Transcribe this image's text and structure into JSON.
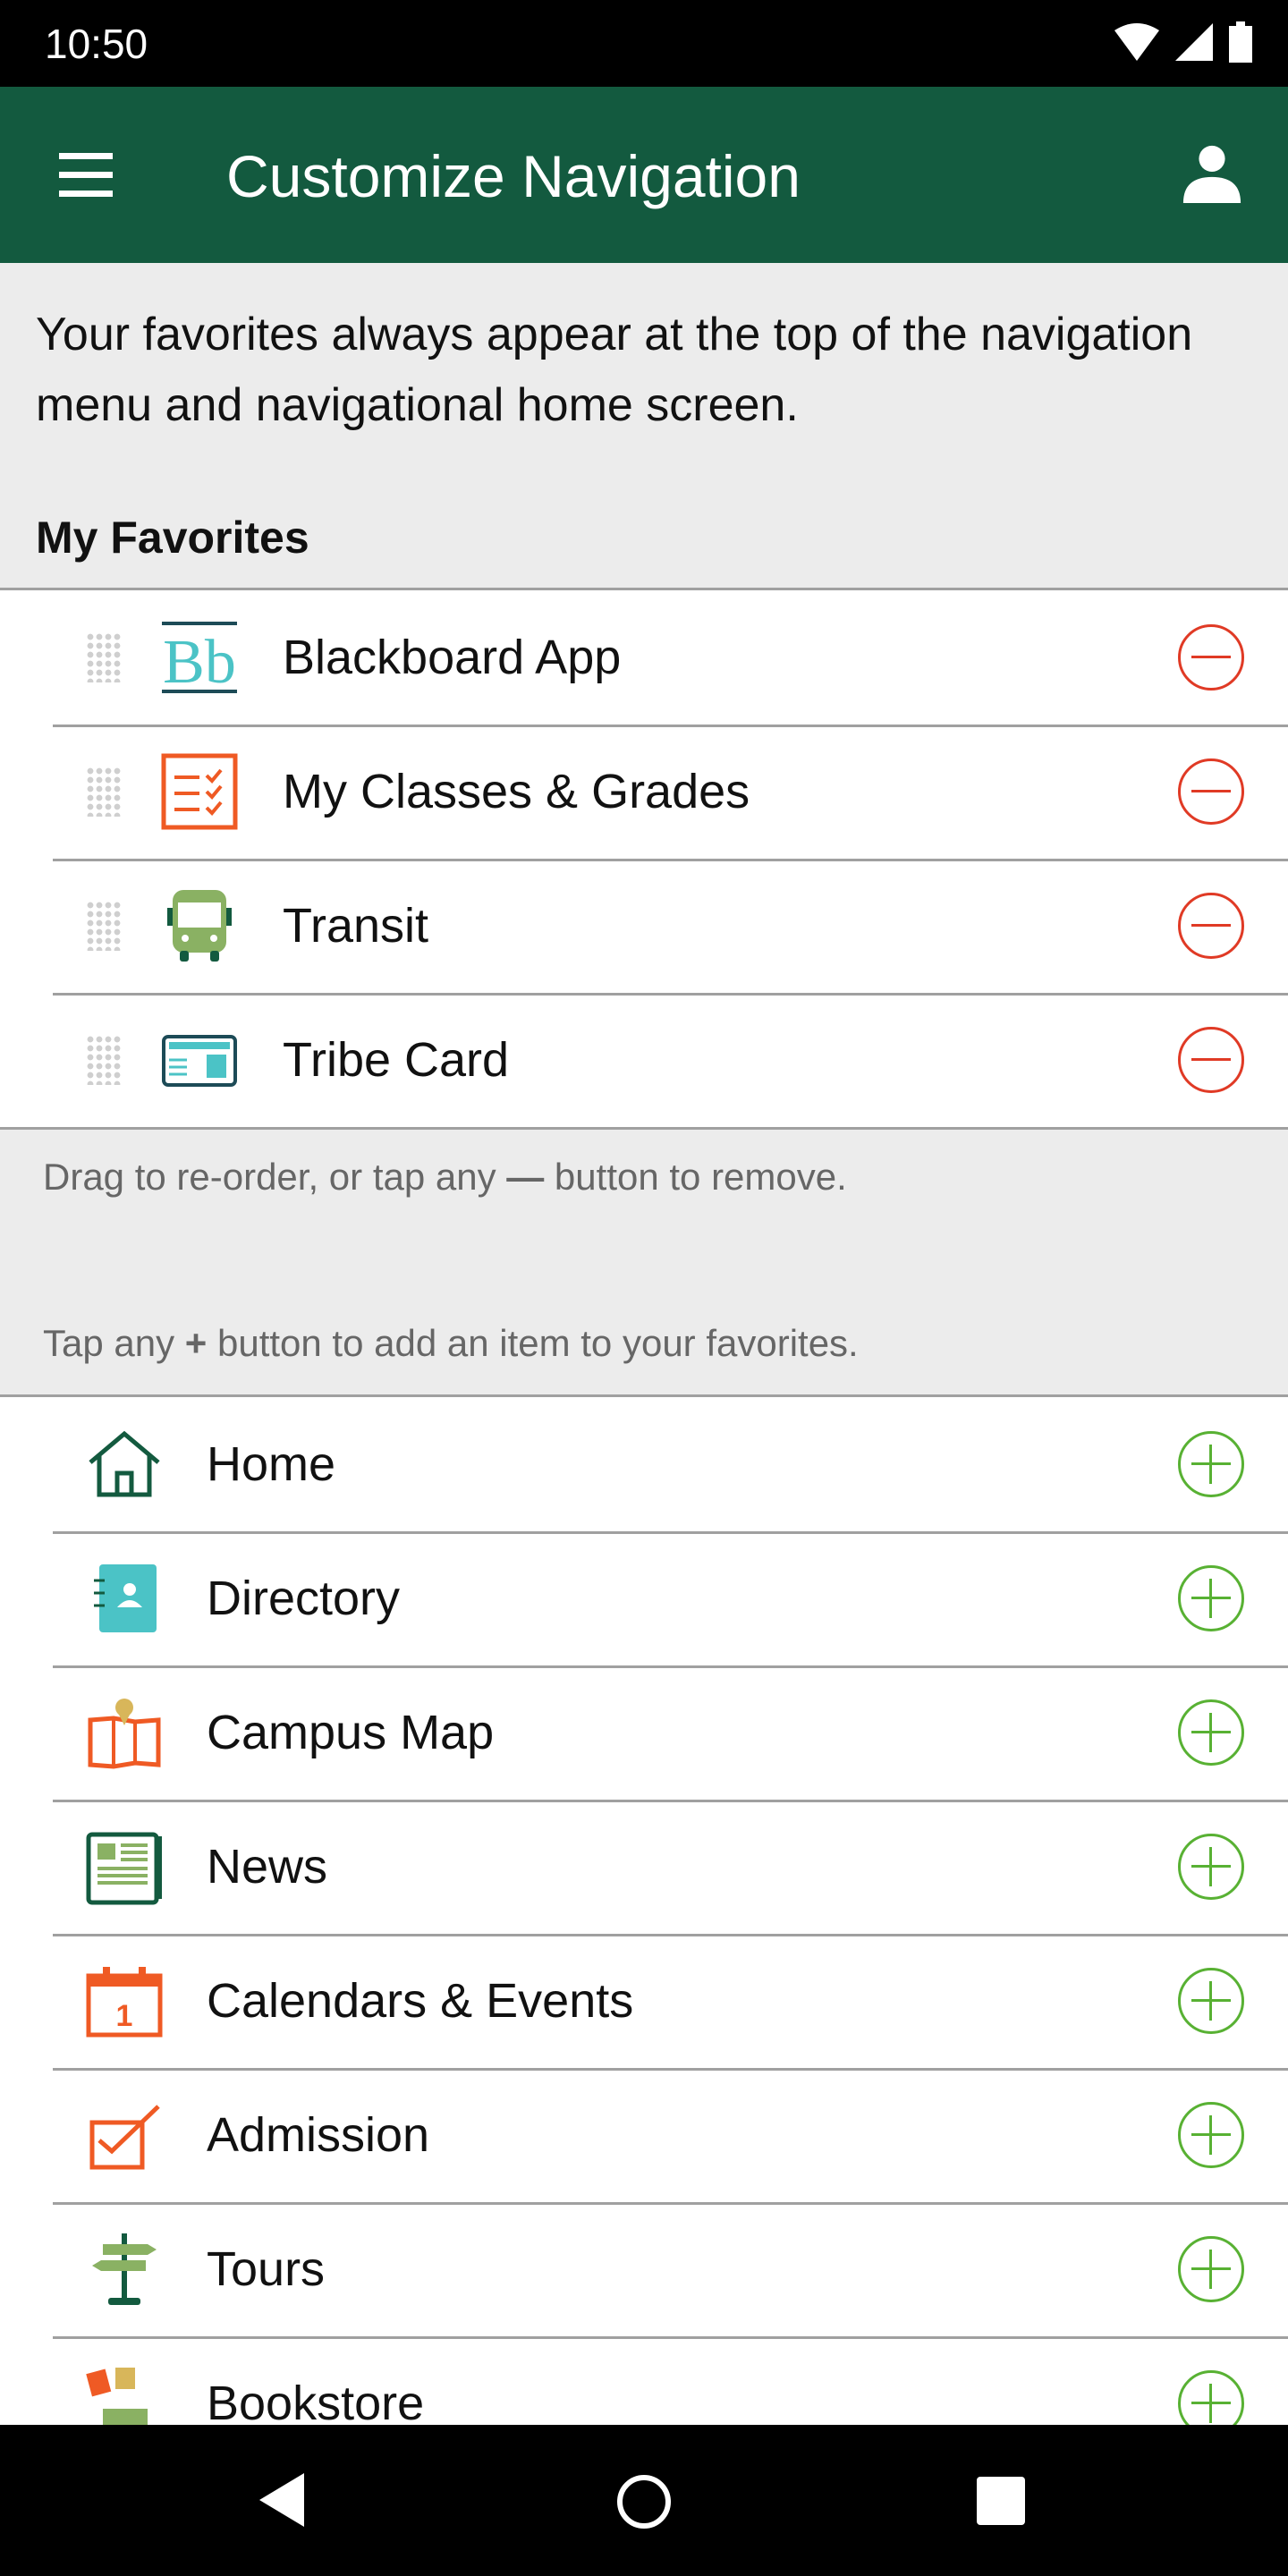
{
  "status_bar": {
    "time": "10:50"
  },
  "app_bar": {
    "title": "Customize Navigation",
    "menu_icon": "hamburger-icon",
    "profile_icon": "user-icon"
  },
  "intro": "Your favorites always appear at the top of the navigation menu and navigational home screen.",
  "favorites": {
    "heading": "My Favorites",
    "items": [
      {
        "label": "Blackboard App",
        "icon": "blackboard-icon"
      },
      {
        "label": "My Classes & Grades",
        "icon": "checklist-icon"
      },
      {
        "label": "Transit",
        "icon": "bus-icon"
      },
      {
        "label": "Tribe Card",
        "icon": "id-card-icon"
      }
    ]
  },
  "hints": {
    "reorder_before": "Drag to re-order, or tap any ",
    "reorder_symbol": "—",
    "reorder_after": " button to remove.",
    "add_before": "Tap any ",
    "add_symbol": "+",
    "add_after": " button to add an item to your favorites."
  },
  "available": {
    "items": [
      {
        "label": "Home",
        "icon": "home-icon"
      },
      {
        "label": "Directory",
        "icon": "directory-icon"
      },
      {
        "label": "Campus Map",
        "icon": "map-icon"
      },
      {
        "label": "News",
        "icon": "news-icon"
      },
      {
        "label": "Calendars & Events",
        "icon": "calendar-icon"
      },
      {
        "label": "Admission",
        "icon": "admission-icon"
      },
      {
        "label": "Tours",
        "icon": "signpost-icon"
      },
      {
        "label": "Bookstore",
        "icon": "bookstore-icon"
      }
    ]
  },
  "colors": {
    "primary": "#135a3f",
    "remove": "#e03a25",
    "add": "#58b133",
    "accent_orange": "#ef5a24",
    "accent_teal": "#4bc3c6"
  }
}
